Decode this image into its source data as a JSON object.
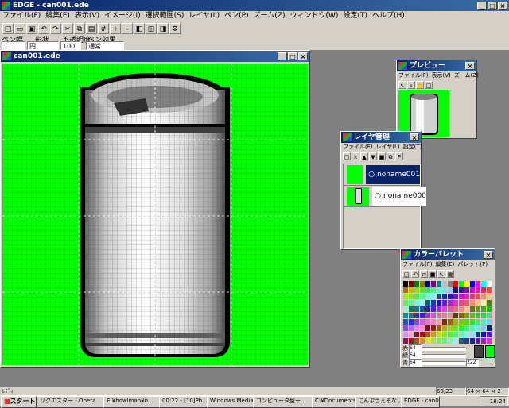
{
  "app": {
    "title": "EDGE - can001.ede",
    "menu": [
      "ファイル(F)",
      "編集(E)",
      "表示(V)",
      "イメージ(I)",
      "選択範囲(S)",
      "レイヤ(L)",
      "ペン(P)",
      "ズーム(Z)",
      "ウィンドウ(W)",
      "設定(T)",
      "ヘルプ(H)"
    ]
  },
  "options": {
    "labels": [
      "ペン幅",
      "形状",
      "不透明度",
      "ペン効果"
    ],
    "values": [
      "1",
      "円",
      "100",
      "通常"
    ]
  },
  "canvas_window": {
    "title": "can001.ede"
  },
  "preview_window": {
    "title": "プレビュー",
    "menu": [
      "ファイル(F)",
      "表示(V)",
      "ズーム(Z)"
    ]
  },
  "layer_window": {
    "title": "レイヤ管理",
    "menu": [
      "ファイル(F)",
      "レイヤ(L)",
      "設定(T)"
    ],
    "layers": [
      {
        "name": "noname001",
        "selected": true
      },
      {
        "name": "noname000",
        "selected": false
      }
    ]
  },
  "palette_window": {
    "title": "カラーパレット",
    "menu": [
      "ファイル(F)",
      "編集(E)",
      "パレット(P)"
    ],
    "rgb": [
      {
        "label": "赤",
        "value": "64"
      },
      {
        "label": "緑",
        "value": "64"
      },
      {
        "label": "青",
        "value": "64"
      }
    ],
    "index": "222",
    "colors": {
      "current": "#404040",
      "background": "#00ff00"
    }
  },
  "status": {
    "left": "ﾚﾃﾞｨ",
    "coords": "63,23",
    "size": "64 × 64 × 2"
  },
  "taskbar": {
    "start": "スタート",
    "buttons": [
      "リクエスター - Opera",
      "E:¥howlman¥n...",
      "00:22 - [10]Ph...",
      "Windows Media ...",
      "コンピュータ型ー...",
      "C:¥Documents ...",
      "にんぷうぇるない...",
      "EDGE - can0..."
    ],
    "clock": "18:24"
  }
}
